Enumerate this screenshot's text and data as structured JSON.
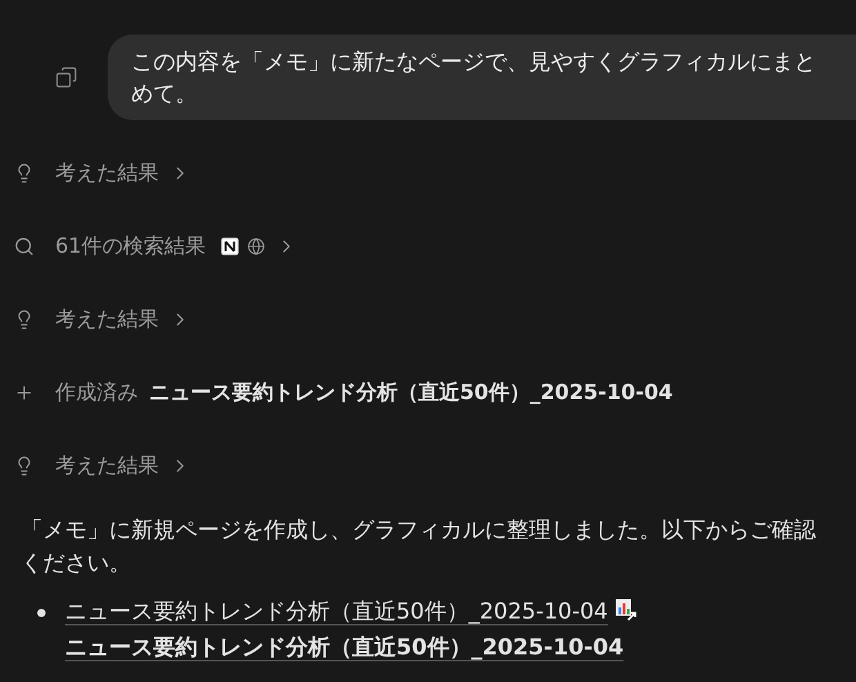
{
  "user_message": {
    "text": "この内容を「メモ」に新たなページで、見やすくグラフィカルにまとめて。"
  },
  "steps": [
    {
      "kind": "thought",
      "label": "考えた結果"
    },
    {
      "kind": "search",
      "label": "61件の検索結果"
    },
    {
      "kind": "thought",
      "label": "考えた結果"
    },
    {
      "kind": "created",
      "label": "作成済み",
      "page": "ニュース要約トレンド分析（直近50件）_2025-10-04"
    },
    {
      "kind": "thought",
      "label": "考えた結果"
    }
  ],
  "response": {
    "text": "「メモ」に新規ページを作成し、グラフィカルに整理しました。以下からご確認ください。",
    "items": [
      {
        "title": "ニュース要約トレンド分析（直近50件）_2025-10-04",
        "link": "ニュース要約トレンド分析（直近50件）_2025-10-04"
      }
    ]
  }
}
